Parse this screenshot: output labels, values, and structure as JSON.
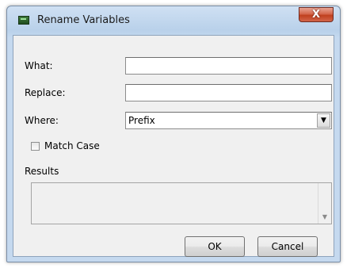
{
  "window": {
    "title": "Rename Variables",
    "close_glyph": "X",
    "app_icon": "app-window-icon"
  },
  "form": {
    "what_label": "What:",
    "what_value": "",
    "replace_label": "Replace:",
    "replace_value": "",
    "where_label": "Where:",
    "where_value": "Prefix",
    "where_arrow": "▼",
    "match_case_label": "Match Case",
    "match_case_checked": false,
    "results_label": "Results",
    "results_scroll_glyph": "▼"
  },
  "buttons": {
    "ok_label": "OK",
    "cancel_label": "Cancel"
  },
  "colors": {
    "client_bg": "#f0f0f0",
    "close_red": "#c0401f",
    "title_frame": "#b9d1ea"
  }
}
